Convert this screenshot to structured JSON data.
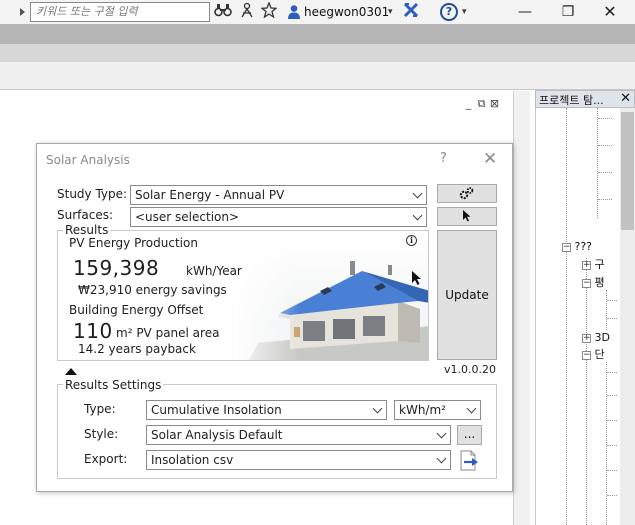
{
  "titlebar": {
    "search_placeholder": "키워드 또는 구절 입력",
    "username": "heegwon0301",
    "icons": [
      "binoculars-icon",
      "sign-in-person-icon",
      "star-icon",
      "user-icon",
      "exchange-x-icon",
      "help-icon"
    ],
    "dropdown_glyph": "▾",
    "help_glyph": "?",
    "window_controls": {
      "minimize": "—",
      "restore": "❐",
      "close": "✕"
    }
  },
  "view": {
    "controls": [
      "_",
      "⧉",
      "⊠"
    ]
  },
  "browser": {
    "title": "프로젝트 탐...",
    "close_glyph": "✕",
    "nodes": [
      {
        "toggle": "−",
        "label": "???"
      },
      {
        "toggle": "+",
        "label": "구"
      },
      {
        "toggle": "−",
        "label": "평"
      },
      {
        "toggle": "+",
        "label": "3D"
      },
      {
        "toggle": "−",
        "label": "단"
      }
    ]
  },
  "dialog": {
    "title": "Solar Analysis",
    "help_glyph": "?",
    "close_glyph": "✕",
    "study_type_label": "Study Type:",
    "study_type_value": "Solar Energy - Annual PV",
    "surfaces_label": "Surfaces:",
    "surfaces_value": "<user selection>",
    "results_label": "Results",
    "pv_heading": "PV Energy Production",
    "pv_value": "159,398",
    "pv_unit": "kWh/Year",
    "savings": "₩23,910 energy savings",
    "offset_heading": "Building Energy Offset",
    "offset_value": "110",
    "offset_unit": "m² PV panel area",
    "payback": "14.2 years payback",
    "update_label": "Update",
    "version": "v1.0.0.20",
    "settings_label": "Results Settings",
    "type_label": "Type:",
    "type_value": "Cumulative Insolation",
    "unit_value": "kWh/m²",
    "style_label": "Style:",
    "style_value": "Solar Analysis Default",
    "style_more": "...",
    "export_label": "Export:",
    "export_value": "Insolation csv"
  },
  "colors": {
    "accent_blue": "#2d5ebf",
    "roof_blue": "#4a7fd6",
    "button_gray": "#e1e1e1"
  }
}
